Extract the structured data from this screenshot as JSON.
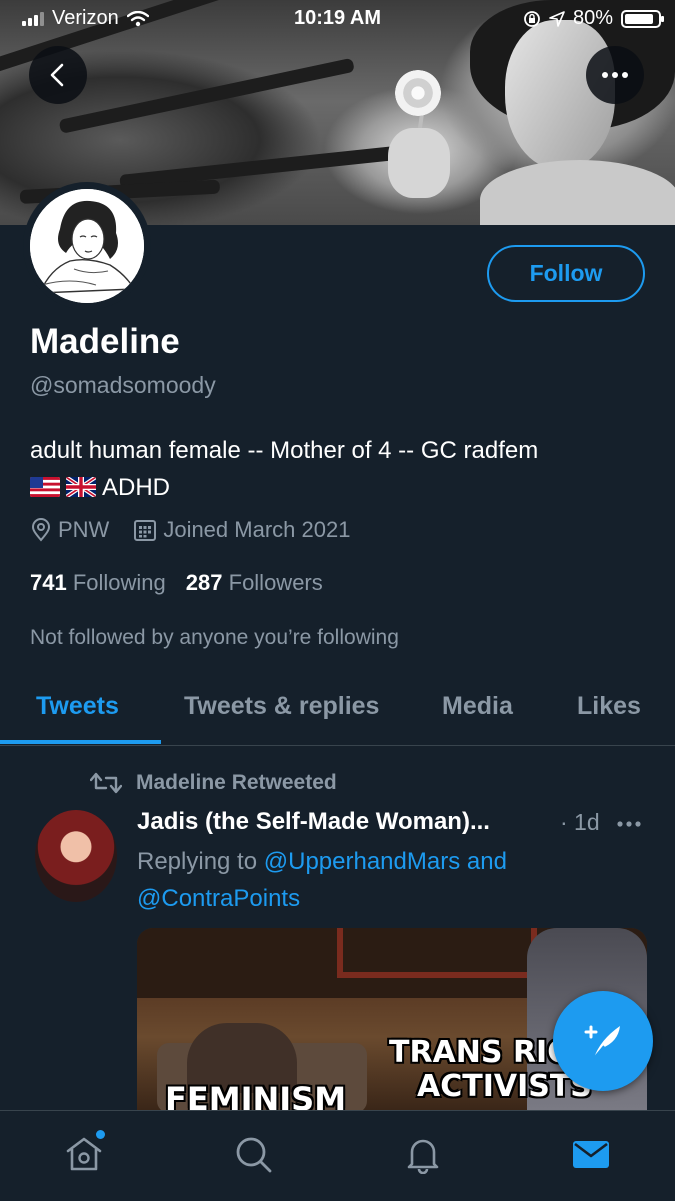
{
  "status_bar": {
    "carrier": "Verizon",
    "time": "10:19 AM",
    "battery": "80%",
    "battery_level": 0.8
  },
  "profile": {
    "name": "Madeline",
    "handle": "@somadsomoody",
    "bio_line1": "adult human female -- Mother of 4 -- GC radfem",
    "bio_line2": "ADHD",
    "location": "PNW",
    "joined": "Joined March 2021",
    "following_count": "741",
    "following_label": "Following",
    "followers_count": "287",
    "followers_label": "Followers",
    "not_followed_text": "Not followed by anyone you’re following",
    "follow_label": "Follow"
  },
  "tabs": [
    {
      "label": "Tweets",
      "active": true
    },
    {
      "label": "Tweets & replies",
      "active": false
    },
    {
      "label": "Media",
      "active": false
    },
    {
      "label": "Likes",
      "active": false
    }
  ],
  "tweet": {
    "retweet_text": "Madeline Retweeted",
    "author": "Jadis (the Self-Made Woman)...",
    "time": "· 1d",
    "replying_prefix": "Replying to",
    "reply_user1": "@UpperhandMars",
    "reply_and": "and",
    "reply_user2": "@ContraPoints",
    "media_text1": "TRANS RIGH",
    "media_text2": "ACTIVISTS",
    "media_text3": "FEMINISM"
  },
  "icons": {
    "back": "back-arrow-icon",
    "more": "more-icon",
    "location": "location-pin-icon",
    "calendar": "calendar-icon",
    "retweet": "retweet-icon",
    "compose": "compose-tweet-icon",
    "home": "home-icon",
    "search": "search-icon",
    "notifications": "bell-icon",
    "messages": "mail-icon"
  },
  "colors": {
    "background": "#15202b",
    "accent": "#1d9bf0",
    "secondary_text": "#8b98a5",
    "divider": "#38444d"
  }
}
